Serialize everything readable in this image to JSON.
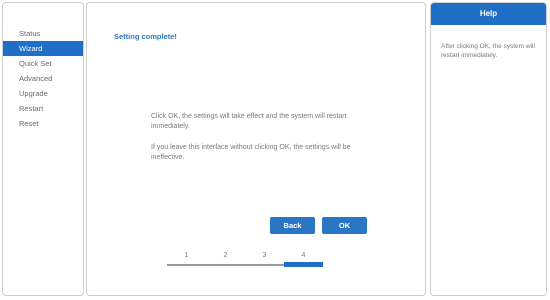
{
  "sidebar": {
    "items": [
      {
        "label": "Status",
        "active": false
      },
      {
        "label": "Wizard",
        "active": true
      },
      {
        "label": "Quick Set",
        "active": false
      },
      {
        "label": "Advanced",
        "active": false
      },
      {
        "label": "Upgrade",
        "active": false
      },
      {
        "label": "Restart",
        "active": false
      },
      {
        "label": "Reset",
        "active": false
      }
    ]
  },
  "main": {
    "title": "Setting complete!",
    "message1": "Click OK, the settings will take effect and the system will restart immediately.",
    "message2": "If you leave this interface without clicking OK, the settings will be ineffective.",
    "back_label": "Back",
    "ok_label": "OK",
    "steps": [
      "1",
      "2",
      "3",
      "4"
    ],
    "current_step": 4
  },
  "help": {
    "title": "Help",
    "text": "After clicking OK, the system will restart immediately."
  },
  "colors": {
    "accent": "#1f6fc6",
    "title_text": "#2f78c8",
    "body_text": "#7a7a7a"
  }
}
